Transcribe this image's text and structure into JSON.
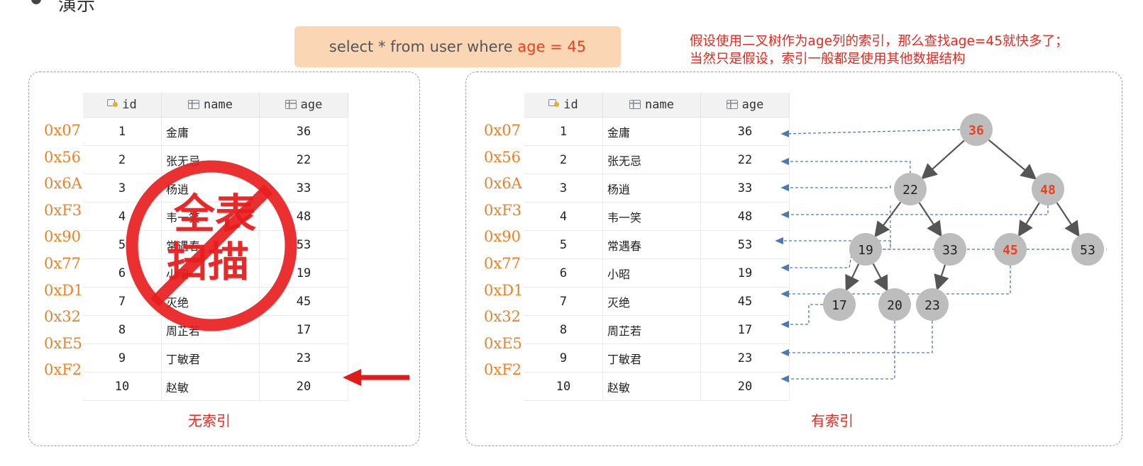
{
  "heading": "演示",
  "sql": {
    "prefix": "select * from user where ",
    "highlight": "age = 45"
  },
  "note": {
    "line1": "假设使用二叉树作为age列的索引，那么查找age=45就快多了；",
    "line2": "当然只是假设，索引一般都是使用其他数据结构"
  },
  "columns": {
    "id": "id",
    "name": "name",
    "age": "age"
  },
  "rows": [
    {
      "addr": "0x07",
      "id": "1",
      "name": "金庸",
      "age": "36"
    },
    {
      "addr": "0x56",
      "id": "2",
      "name": "张无忌",
      "age": "22"
    },
    {
      "addr": "0x6A",
      "id": "3",
      "name": "杨逍",
      "age": "33"
    },
    {
      "addr": "0xF3",
      "id": "4",
      "name": "韦一笑",
      "age": "48"
    },
    {
      "addr": "0x90",
      "id": "5",
      "name": "常遇春",
      "age": "53"
    },
    {
      "addr": "0x77",
      "id": "6",
      "name": "小昭",
      "age": "19"
    },
    {
      "addr": "0xD1",
      "id": "7",
      "name": "灭绝",
      "age": "45"
    },
    {
      "addr": "0x32",
      "id": "8",
      "name": "周芷若",
      "age": "17"
    },
    {
      "addr": "0xE5",
      "id": "9",
      "name": "丁敏君",
      "age": "23"
    },
    {
      "addr": "0xF2",
      "id": "10",
      "name": "赵敏",
      "age": "20"
    }
  ],
  "stamp": {
    "line1": "全表",
    "line2": "扫描"
  },
  "labels": {
    "no_index": "无索引",
    "with_index": "有索引"
  },
  "tree_nodes": [
    "36",
    "22",
    "48",
    "19",
    "33",
    "45",
    "53",
    "17",
    "20",
    "23"
  ],
  "highlight_nodes": [
    "36",
    "48",
    "45"
  ],
  "colors": {
    "accent": "#e8421f",
    "address": "#e8822a",
    "node": "#bdbdbd",
    "pointer": "#4a7ab5"
  }
}
